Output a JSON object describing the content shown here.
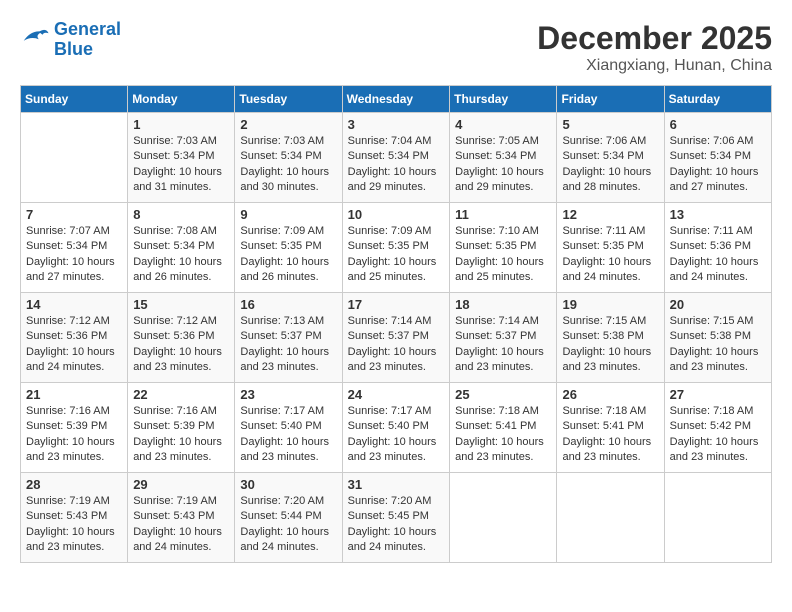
{
  "header": {
    "logo_line1": "General",
    "logo_line2": "Blue",
    "month": "December 2025",
    "location": "Xiangxiang, Hunan, China"
  },
  "days_of_week": [
    "Sunday",
    "Monday",
    "Tuesday",
    "Wednesday",
    "Thursday",
    "Friday",
    "Saturday"
  ],
  "weeks": [
    [
      {
        "day": "",
        "info": ""
      },
      {
        "day": "1",
        "info": "Sunrise: 7:03 AM\nSunset: 5:34 PM\nDaylight: 10 hours\nand 31 minutes."
      },
      {
        "day": "2",
        "info": "Sunrise: 7:03 AM\nSunset: 5:34 PM\nDaylight: 10 hours\nand 30 minutes."
      },
      {
        "day": "3",
        "info": "Sunrise: 7:04 AM\nSunset: 5:34 PM\nDaylight: 10 hours\nand 29 minutes."
      },
      {
        "day": "4",
        "info": "Sunrise: 7:05 AM\nSunset: 5:34 PM\nDaylight: 10 hours\nand 29 minutes."
      },
      {
        "day": "5",
        "info": "Sunrise: 7:06 AM\nSunset: 5:34 PM\nDaylight: 10 hours\nand 28 minutes."
      },
      {
        "day": "6",
        "info": "Sunrise: 7:06 AM\nSunset: 5:34 PM\nDaylight: 10 hours\nand 27 minutes."
      }
    ],
    [
      {
        "day": "7",
        "info": "Sunrise: 7:07 AM\nSunset: 5:34 PM\nDaylight: 10 hours\nand 27 minutes."
      },
      {
        "day": "8",
        "info": "Sunrise: 7:08 AM\nSunset: 5:34 PM\nDaylight: 10 hours\nand 26 minutes."
      },
      {
        "day": "9",
        "info": "Sunrise: 7:09 AM\nSunset: 5:35 PM\nDaylight: 10 hours\nand 26 minutes."
      },
      {
        "day": "10",
        "info": "Sunrise: 7:09 AM\nSunset: 5:35 PM\nDaylight: 10 hours\nand 25 minutes."
      },
      {
        "day": "11",
        "info": "Sunrise: 7:10 AM\nSunset: 5:35 PM\nDaylight: 10 hours\nand 25 minutes."
      },
      {
        "day": "12",
        "info": "Sunrise: 7:11 AM\nSunset: 5:35 PM\nDaylight: 10 hours\nand 24 minutes."
      },
      {
        "day": "13",
        "info": "Sunrise: 7:11 AM\nSunset: 5:36 PM\nDaylight: 10 hours\nand 24 minutes."
      }
    ],
    [
      {
        "day": "14",
        "info": "Sunrise: 7:12 AM\nSunset: 5:36 PM\nDaylight: 10 hours\nand 24 minutes."
      },
      {
        "day": "15",
        "info": "Sunrise: 7:12 AM\nSunset: 5:36 PM\nDaylight: 10 hours\nand 23 minutes."
      },
      {
        "day": "16",
        "info": "Sunrise: 7:13 AM\nSunset: 5:37 PM\nDaylight: 10 hours\nand 23 minutes."
      },
      {
        "day": "17",
        "info": "Sunrise: 7:14 AM\nSunset: 5:37 PM\nDaylight: 10 hours\nand 23 minutes."
      },
      {
        "day": "18",
        "info": "Sunrise: 7:14 AM\nSunset: 5:37 PM\nDaylight: 10 hours\nand 23 minutes."
      },
      {
        "day": "19",
        "info": "Sunrise: 7:15 AM\nSunset: 5:38 PM\nDaylight: 10 hours\nand 23 minutes."
      },
      {
        "day": "20",
        "info": "Sunrise: 7:15 AM\nSunset: 5:38 PM\nDaylight: 10 hours\nand 23 minutes."
      }
    ],
    [
      {
        "day": "21",
        "info": "Sunrise: 7:16 AM\nSunset: 5:39 PM\nDaylight: 10 hours\nand 23 minutes."
      },
      {
        "day": "22",
        "info": "Sunrise: 7:16 AM\nSunset: 5:39 PM\nDaylight: 10 hours\nand 23 minutes."
      },
      {
        "day": "23",
        "info": "Sunrise: 7:17 AM\nSunset: 5:40 PM\nDaylight: 10 hours\nand 23 minutes."
      },
      {
        "day": "24",
        "info": "Sunrise: 7:17 AM\nSunset: 5:40 PM\nDaylight: 10 hours\nand 23 minutes."
      },
      {
        "day": "25",
        "info": "Sunrise: 7:18 AM\nSunset: 5:41 PM\nDaylight: 10 hours\nand 23 minutes."
      },
      {
        "day": "26",
        "info": "Sunrise: 7:18 AM\nSunset: 5:41 PM\nDaylight: 10 hours\nand 23 minutes."
      },
      {
        "day": "27",
        "info": "Sunrise: 7:18 AM\nSunset: 5:42 PM\nDaylight: 10 hours\nand 23 minutes."
      }
    ],
    [
      {
        "day": "28",
        "info": "Sunrise: 7:19 AM\nSunset: 5:43 PM\nDaylight: 10 hours\nand 23 minutes."
      },
      {
        "day": "29",
        "info": "Sunrise: 7:19 AM\nSunset: 5:43 PM\nDaylight: 10 hours\nand 24 minutes."
      },
      {
        "day": "30",
        "info": "Sunrise: 7:20 AM\nSunset: 5:44 PM\nDaylight: 10 hours\nand 24 minutes."
      },
      {
        "day": "31",
        "info": "Sunrise: 7:20 AM\nSunset: 5:45 PM\nDaylight: 10 hours\nand 24 minutes."
      },
      {
        "day": "",
        "info": ""
      },
      {
        "day": "",
        "info": ""
      },
      {
        "day": "",
        "info": ""
      }
    ]
  ]
}
